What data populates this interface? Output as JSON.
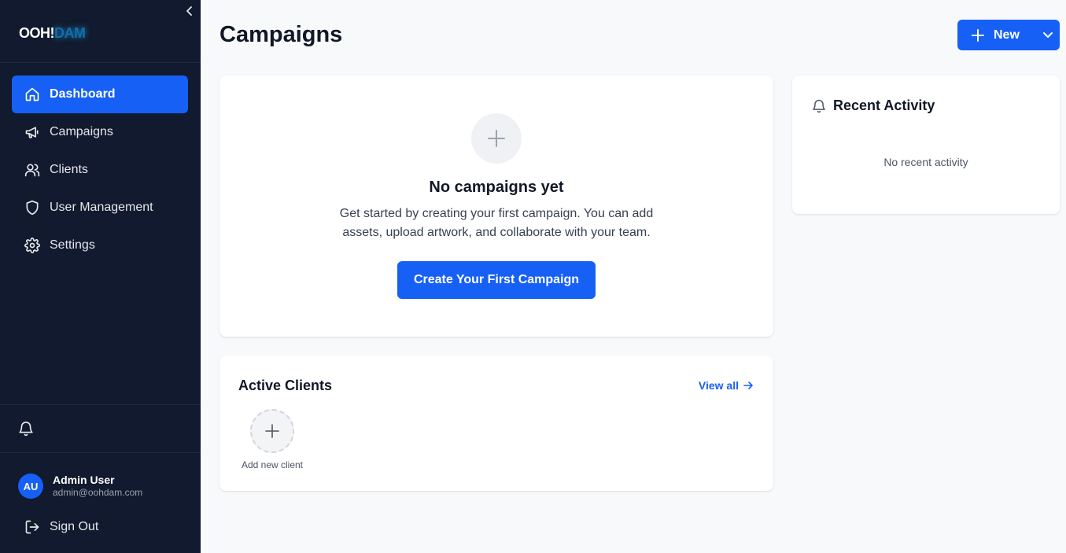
{
  "app": {
    "logo_part1": "OOH!",
    "logo_part2": "DAM"
  },
  "sidebar": {
    "items": [
      {
        "label": "Dashboard",
        "icon": "home-icon",
        "active": true
      },
      {
        "label": "Campaigns",
        "icon": "megaphone-icon",
        "active": false
      },
      {
        "label": "Clients",
        "icon": "users-icon",
        "active": false
      },
      {
        "label": "User Management",
        "icon": "shield-icon",
        "active": false
      },
      {
        "label": "Settings",
        "icon": "gear-icon",
        "active": false
      }
    ],
    "user": {
      "initials": "AU",
      "name": "Admin User",
      "email": "admin@oohdam.com"
    },
    "sign_out_label": "Sign Out"
  },
  "header": {
    "title": "Campaigns",
    "new_button_label": "New"
  },
  "empty_state": {
    "title": "No campaigns yet",
    "description": "Get started by creating your first campaign. You can add assets, upload artwork, and collaborate with your team.",
    "cta_label": "Create Your First Campaign"
  },
  "active_clients": {
    "title": "Active Clients",
    "view_all_label": "View all",
    "add_client_label": "Add new client"
  },
  "recent_activity": {
    "title": "Recent Activity",
    "empty_text": "No recent activity"
  },
  "colors": {
    "accent": "#1660f5",
    "sidebar_bg": "#111a2e",
    "page_bg": "#f8f9fb"
  }
}
